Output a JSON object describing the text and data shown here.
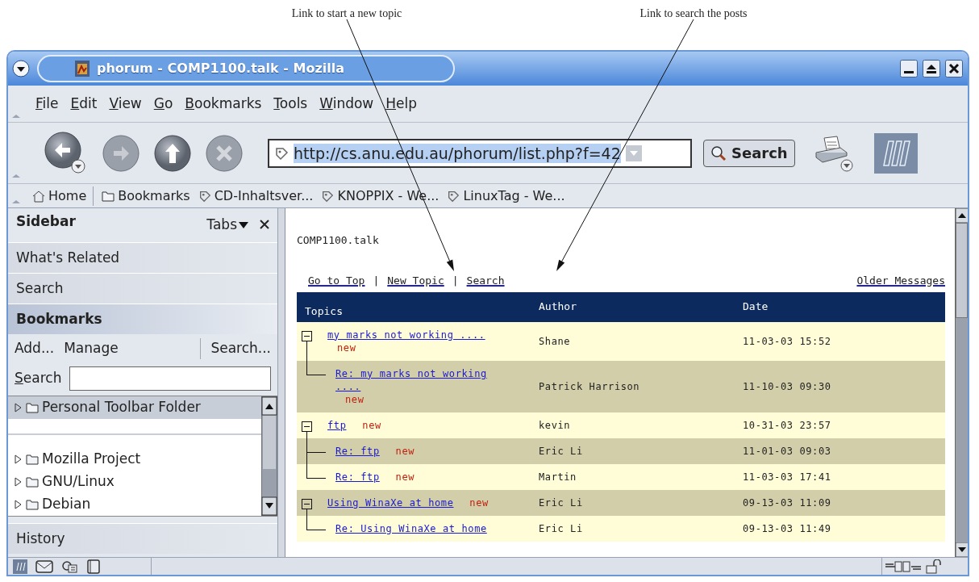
{
  "annotations": [
    {
      "text": "Link to start a new topic"
    },
    {
      "text": "Link to search the posts"
    }
  ],
  "window": {
    "title": "phorum - COMP1100.talk - Mozilla"
  },
  "menu": [
    "File",
    "Edit",
    "View",
    "Go",
    "Bookmarks",
    "Tools",
    "Window",
    "Help"
  ],
  "navigation": {
    "url": "http://cs.anu.edu.au/phorum/list.php?f=42",
    "search_button": "Search"
  },
  "bookmarks_bar": [
    {
      "kind": "home",
      "label": "Home"
    },
    {
      "kind": "folder",
      "label": "Bookmarks"
    },
    {
      "kind": "link",
      "label": "CD-Inhaltsver..."
    },
    {
      "kind": "link",
      "label": "KNOPPIX - We..."
    },
    {
      "kind": "link",
      "label": "LinuxTag - We..."
    }
  ],
  "sidebar": {
    "title": "Sidebar",
    "tabs_menu": "Tabs",
    "tabs": [
      {
        "label": "What's Related",
        "selected": false
      },
      {
        "label": "Search",
        "selected": false
      },
      {
        "label": "Bookmarks",
        "selected": true
      },
      {
        "label": "History",
        "selected": false
      }
    ],
    "bookmarks_panel": {
      "actions": [
        "Add...",
        "Manage",
        "Search..."
      ],
      "search_label": "Search",
      "items": [
        {
          "kind": "folder",
          "label": "Personal Toolbar Folder",
          "selected": true,
          "expanded": false
        },
        {
          "kind": "separator"
        },
        {
          "kind": "folder",
          "label": "Mozilla Project",
          "selected": false,
          "expanded": false
        },
        {
          "kind": "folder",
          "label": "GNU/Linux",
          "selected": false,
          "expanded": false
        },
        {
          "kind": "folder",
          "label": "Debian",
          "selected": false,
          "expanded": false
        }
      ]
    }
  },
  "page": {
    "forum_name": "COMP1100.talk",
    "nav_links": [
      "Go to Top",
      "New Topic",
      "Search"
    ],
    "link_separator": "|",
    "older_link": "Older Messages",
    "table": {
      "columns": [
        "Topics",
        "Author",
        "Date"
      ],
      "threads": [
        {
          "title": "my marks not working ....",
          "badge": "new",
          "author": "Shane",
          "date": "11-03-03 15:52",
          "children": [
            {
              "title": "Re: my marks not working ....",
              "badge": "new",
              "author": "Patrick Harrison",
              "date": "11-10-03 09:30"
            }
          ]
        },
        {
          "title": "ftp",
          "badge": "new",
          "author": "kevin",
          "date": "10-31-03 23:57",
          "children": [
            {
              "title": "Re: ftp",
              "badge": "new",
              "author": "Eric Li",
              "date": "11-01-03 09:03"
            },
            {
              "title": "Re: ftp",
              "badge": "new",
              "author": "Martin",
              "date": "11-03-03 17:41"
            }
          ]
        },
        {
          "title": "Using WinaXe at home",
          "badge": "new",
          "author": "Eric Li",
          "date": "09-13-03 11:09",
          "children": [
            {
              "title": "Re: Using WinaXe at home",
              "author": "Eric Li",
              "date": "09-13-03 11:49"
            }
          ]
        }
      ]
    }
  }
}
